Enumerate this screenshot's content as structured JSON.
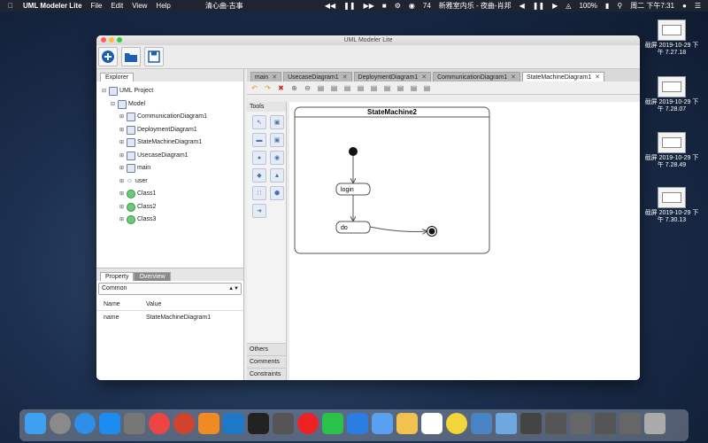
{
  "menubar": {
    "app_name": "UML Modeler Lite",
    "menus": [
      "File",
      "Edit",
      "View",
      "Help"
    ],
    "song_left": "清心曲-古事",
    "wechat_count": "74",
    "song_center": "新雅室内乐 - 夜曲-肖邦",
    "battery": "100%",
    "clock": "周二 下午7:31"
  },
  "desktop": {
    "files": [
      {
        "name_line1": "截屏 2019-10-29 下",
        "name_line2": "午 7.27.18"
      },
      {
        "name_line1": "截屏 2019-10-29 下",
        "name_line2": "午 7.28.07"
      },
      {
        "name_line1": "截屏 2019-10-29 下",
        "name_line2": "午 7.28.49"
      },
      {
        "name_line1": "截屏 2019-10-29 下",
        "name_line2": "午 7.30.13"
      }
    ]
  },
  "window": {
    "title": "UML Modeler Lite"
  },
  "explorer": {
    "tab": "Explorer",
    "tree": [
      {
        "label": "UML Project",
        "level": 0,
        "icon": "project-icon"
      },
      {
        "label": "Model",
        "level": 1,
        "icon": "folder-icon"
      },
      {
        "label": "CommunicationDiagram1",
        "level": 2,
        "icon": "diagram-icon"
      },
      {
        "label": "DeploymentDiagram1",
        "level": 2,
        "icon": "diagram-icon"
      },
      {
        "label": "StateMachineDiagram1",
        "level": 2,
        "icon": "diagram-icon"
      },
      {
        "label": "UsecaseDiagram1",
        "level": 2,
        "icon": "diagram-icon"
      },
      {
        "label": "main",
        "level": 2,
        "icon": "package-icon"
      },
      {
        "label": "user",
        "level": 2,
        "icon": "actor-icon"
      },
      {
        "label": "Class1",
        "level": 2,
        "icon": "class-icon"
      },
      {
        "label": "Class2",
        "level": 2,
        "icon": "class-icon"
      },
      {
        "label": "Class3",
        "level": 2,
        "icon": "class-icon"
      }
    ]
  },
  "properties": {
    "tabs": [
      "Property",
      "Overview"
    ],
    "combo": "Common",
    "headers": {
      "name": "Name",
      "value": "Value"
    },
    "rows": [
      {
        "name": "name",
        "value": "StateMachineDiagram1"
      }
    ]
  },
  "editor": {
    "tabs": [
      "main",
      "UsecaseDiagram1",
      "DeploymentDiagram1",
      "CommunicationDiagram1",
      "StateMachineDiagram1"
    ],
    "active_tab": "StateMachineDiagram1"
  },
  "tools": {
    "title": "Tools",
    "footer": [
      "Others",
      "Comments",
      "Constraints"
    ]
  },
  "diagram": {
    "frame_title": "StateMachine2",
    "states": [
      {
        "label": "login"
      },
      {
        "label": "do"
      }
    ]
  }
}
